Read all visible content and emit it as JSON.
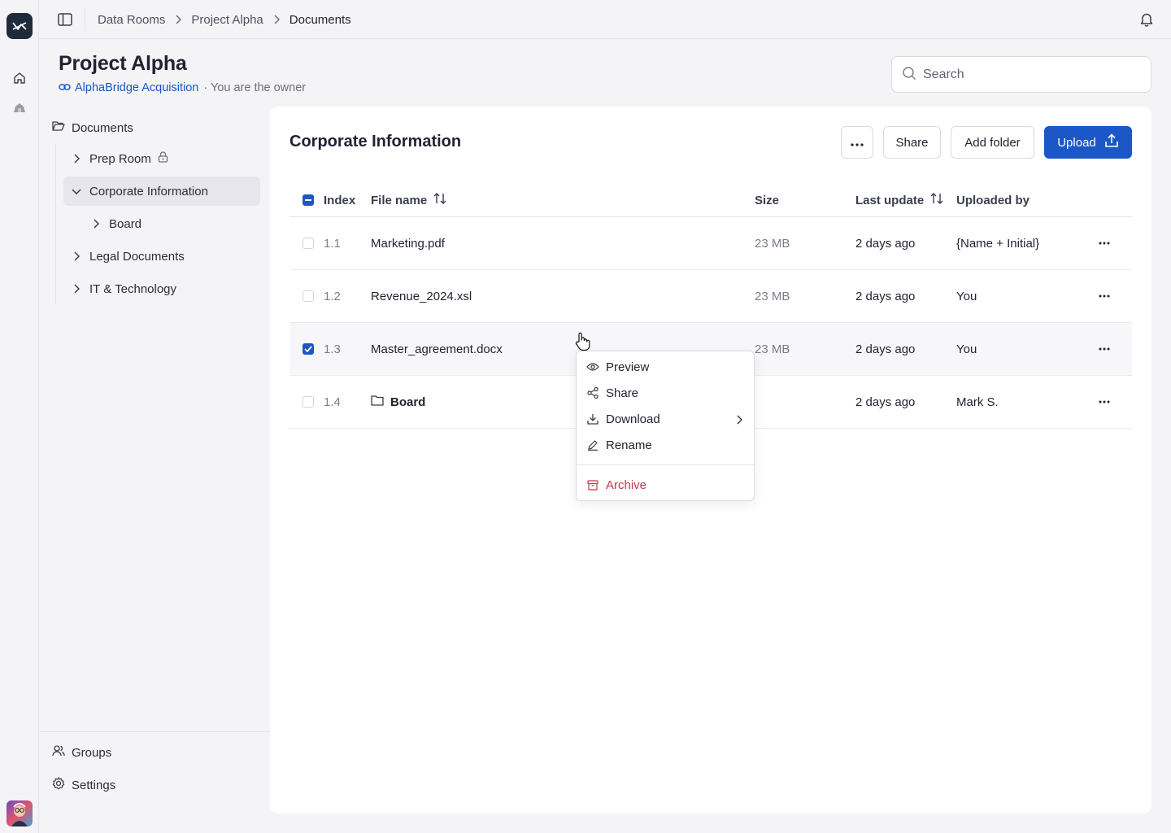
{
  "breadcrumb": [
    "Data Rooms",
    "Project Alpha",
    "Documents"
  ],
  "header": {
    "title": "Project Alpha",
    "link_text": "AlphaBridge Acquisition",
    "owner_text": "· You are the owner",
    "search_placeholder": "Search"
  },
  "tree": {
    "root": "Documents",
    "items": [
      {
        "label": "Prep Room",
        "locked": true
      },
      {
        "label": "Corporate Information",
        "expanded": true,
        "active": true
      },
      {
        "label": "Board"
      },
      {
        "label": "Legal Documents"
      },
      {
        "label": "IT & Technology"
      }
    ]
  },
  "sidebar_bottom": {
    "groups": "Groups",
    "settings": "Settings"
  },
  "panel": {
    "title": "Corporate Information",
    "actions": {
      "share": "Share",
      "add_folder": "Add folder",
      "upload": "Upload"
    }
  },
  "table": {
    "columns": {
      "index": "Index",
      "file_name": "File name",
      "size": "Size",
      "last_update": "Last update",
      "uploaded_by": "Uploaded by"
    },
    "rows": [
      {
        "index": "1.1",
        "name": "Marketing.pdf",
        "size": "23 MB",
        "updated": "2 days ago",
        "by": "{Name + Initial}",
        "checked": false,
        "folder": false
      },
      {
        "index": "1.2",
        "name": "Revenue_2024.xsl",
        "size": "23 MB",
        "updated": "2 days ago",
        "by": "You",
        "checked": false,
        "folder": false
      },
      {
        "index": "1.3",
        "name": "Master_agreement.docx",
        "size": "23 MB",
        "updated": "2 days ago",
        "by": "You",
        "checked": true,
        "folder": false
      },
      {
        "index": "1.4",
        "name": "Board",
        "size": "",
        "updated": "2 days ago",
        "by": "Mark S.",
        "checked": false,
        "folder": true
      }
    ]
  },
  "context_menu": {
    "preview": "Preview",
    "share": "Share",
    "download": "Download",
    "rename": "Rename",
    "archive": "Archive"
  },
  "colors": {
    "accent": "#1b57c6",
    "danger": "#c9354a",
    "background": "#f4f4f6"
  }
}
